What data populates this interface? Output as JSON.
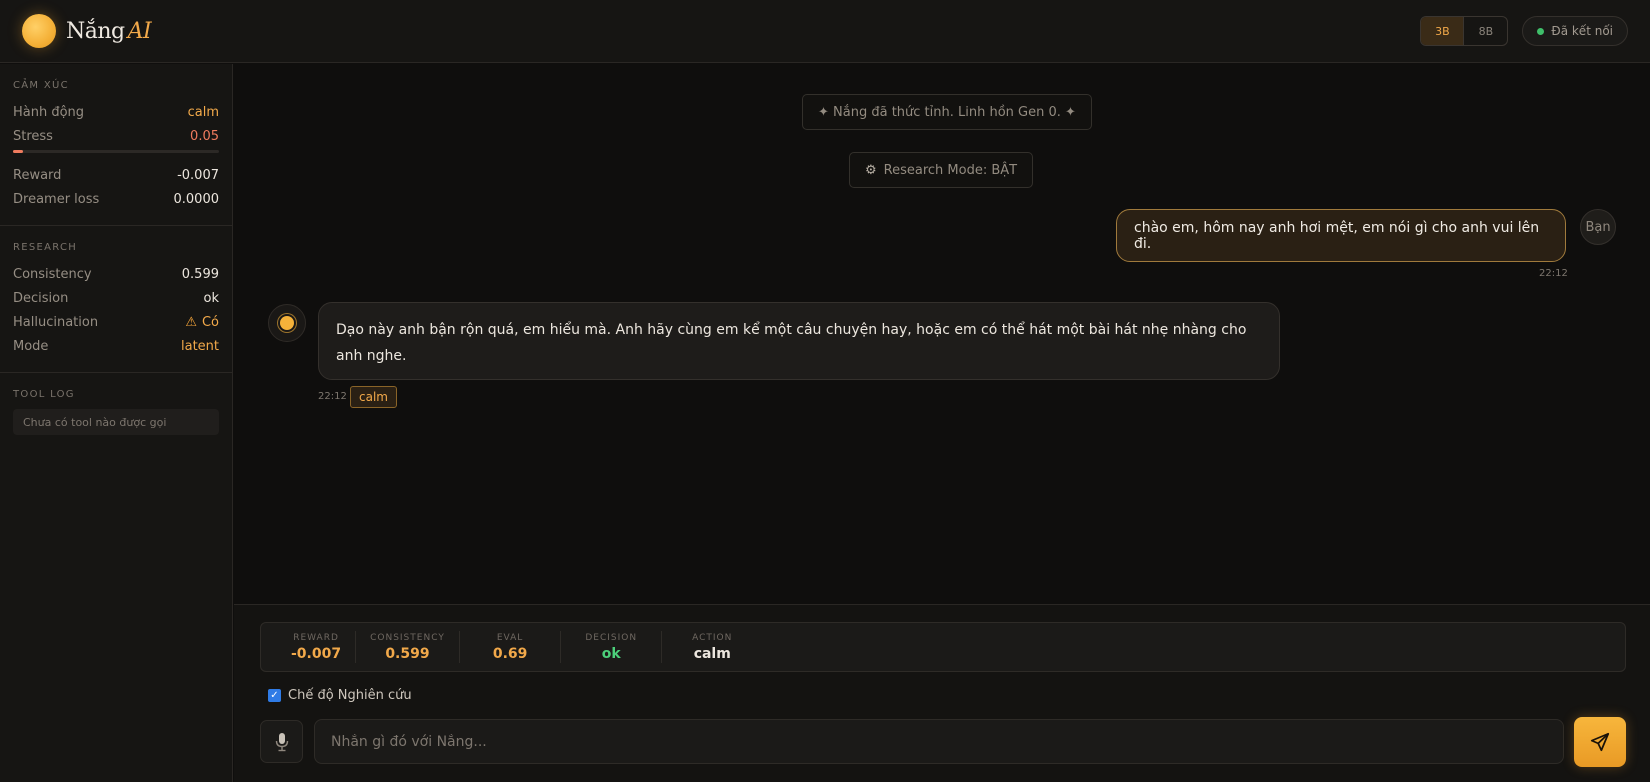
{
  "header": {
    "brand": "Nắng",
    "brand_suffix": "AI",
    "models": [
      "3B",
      "8B"
    ],
    "active_model": "3B",
    "connection": "Đã kết nối"
  },
  "sidebar": {
    "emotion": {
      "title": "CẢM XÚC",
      "action_label": "Hành động",
      "action_value": "calm",
      "stress_label": "Stress",
      "stress_value": "0.05",
      "stress_level": 0.05,
      "reward_label": "Reward",
      "reward_value": "-0.007",
      "dreamer_label": "Dreamer loss",
      "dreamer_value": "0.0000"
    },
    "research": {
      "title": "RESEARCH",
      "consistency_label": "Consistency",
      "consistency_value": "0.599",
      "decision_label": "Decision",
      "decision_value": "ok",
      "hallucination_label": "Hallucination",
      "hallucination_value": "Có",
      "mode_label": "Mode",
      "mode_value": "latent"
    },
    "tool_log": {
      "title": "TOOL LOG",
      "empty_text": "Chưa có tool nào được gọi"
    }
  },
  "chat": {
    "system_1": "✦ Nắng đã thức tỉnh. Linh hồn Gen 0. ✦",
    "system_2": "Research Mode: BẬT",
    "user_message": "chào em, hôm nay anh hơi mệt, em nói gì cho anh vui lên đi.",
    "user_avatar": "Bạn",
    "user_time": "22:12",
    "bot_message": "Dạo này anh bận rộn quá, em hiểu mà. Anh hãy cùng em kể một câu chuyện hay, hoặc em có thể hát một bài hát nhẹ nhàng cho anh nghe.",
    "bot_time": "22:12",
    "bot_emotion": "calm"
  },
  "metrics": {
    "reward_label": "REWARD",
    "reward_value": "-0.007",
    "consistency_label": "CONSISTENCY",
    "consistency_value": "0.599",
    "eval_label": "EVAL",
    "eval_value": "0.69",
    "decision_label": "DECISION",
    "decision_value": "ok",
    "action_label": "ACTION",
    "action_value": "calm"
  },
  "composer": {
    "research_toggle_label": "Chế độ Nghiên cứu",
    "research_checked": true,
    "placeholder": "Nhắn gì đó với Nắng..."
  },
  "colors": {
    "accent": "#f2a94a",
    "danger": "#ef7b5e",
    "ok": "#4ccf7a",
    "connected": "#3fbf6a"
  },
  "icons": [
    "sun-logo-icon",
    "status-dot-icon",
    "warning-icon",
    "gear-icon",
    "sun-avatar-icon",
    "microphone-icon",
    "send-icon",
    "checkbox-icon"
  ]
}
